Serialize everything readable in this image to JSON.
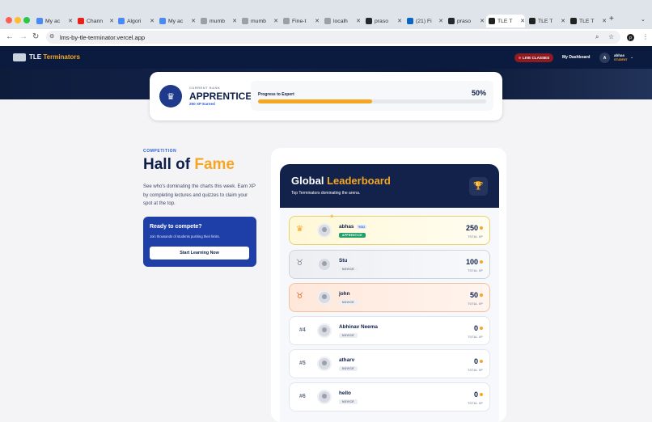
{
  "browser": {
    "tabs": [
      {
        "label": "My ac",
        "color": "#4a8af4"
      },
      {
        "label": "Chann",
        "color": "#e62117"
      },
      {
        "label": "Algori",
        "color": "#4a8af4"
      },
      {
        "label": "My ac",
        "color": "#4a8af4"
      },
      {
        "label": "mumb",
        "color": "#9aa0a6"
      },
      {
        "label": "mumb",
        "color": "#9aa0a6"
      },
      {
        "label": "Fine-t",
        "color": "#9aa0a6"
      },
      {
        "label": "localh",
        "color": "#9aa0a6"
      },
      {
        "label": "praso",
        "color": "#24292f"
      },
      {
        "label": "(21) Fi",
        "color": "#0a66c2"
      },
      {
        "label": "praso",
        "color": "#24292f"
      },
      {
        "label": "TLE T",
        "color": "#222222"
      },
      {
        "label": "TLE T",
        "color": "#222222"
      },
      {
        "label": "TLE T",
        "color": "#222222"
      }
    ],
    "close_glyph": "✕",
    "new_tab_glyph": "+",
    "url": "lms-by-tle-terminator.vercel.app"
  },
  "site": {
    "brand": "TLE ",
    "brand_accent": "Terminators",
    "live_label": "LIVE CLASSES",
    "dashboard_label": "My Dashboard",
    "user_initial": "A",
    "user_name": "abhas",
    "user_role": "STUDENT"
  },
  "rank": {
    "kicker": "CURRENT RANK",
    "title": "APPRENTICE",
    "xp_earned": "250 XP Earned",
    "progress_prefix": "Progress to ",
    "progress_target": "Expert",
    "progress_percent": "50%",
    "progress_value": 0.5
  },
  "hall": {
    "kicker": "COMPETITION",
    "title_plain": "Hall of ",
    "title_accent": "Fame",
    "description": "See who's dominating the charts this week. Earn XP by completing lectures and quizzes to claim your spot at the top.",
    "cta_title": "Ready to compete?",
    "cta_subtitle": "Join thousands of students pushing their limits.",
    "cta_button": "Start Learning Now"
  },
  "leaderboard": {
    "title_plain": "Global ",
    "title_accent": "Leaderboard",
    "subtitle": "Top Terminators dominating the arena.",
    "total_label": "TOTAL XP",
    "you_label": "YOU",
    "rows": [
      {
        "rank": "1",
        "name": "abhas",
        "tag": "APPRENTICE",
        "score": "250"
      },
      {
        "rank": "2",
        "name": "Stu",
        "tag": "NOVICE",
        "score": "100"
      },
      {
        "rank": "3",
        "name": "john",
        "tag": "NOVICE",
        "score": "50"
      },
      {
        "rank": "#4",
        "name": "Abhinav Neema",
        "tag": "NOVICE",
        "score": "0"
      },
      {
        "rank": "#5",
        "name": "atharv",
        "tag": "NOVICE",
        "score": "0"
      },
      {
        "rank": "#6",
        "name": "hello",
        "tag": "NOVICE",
        "score": "0"
      }
    ]
  },
  "colors": {
    "navy": "#0f1f4b",
    "accent": "#f5a623",
    "blue": "#1f3fa8",
    "green": "#22a06b"
  }
}
